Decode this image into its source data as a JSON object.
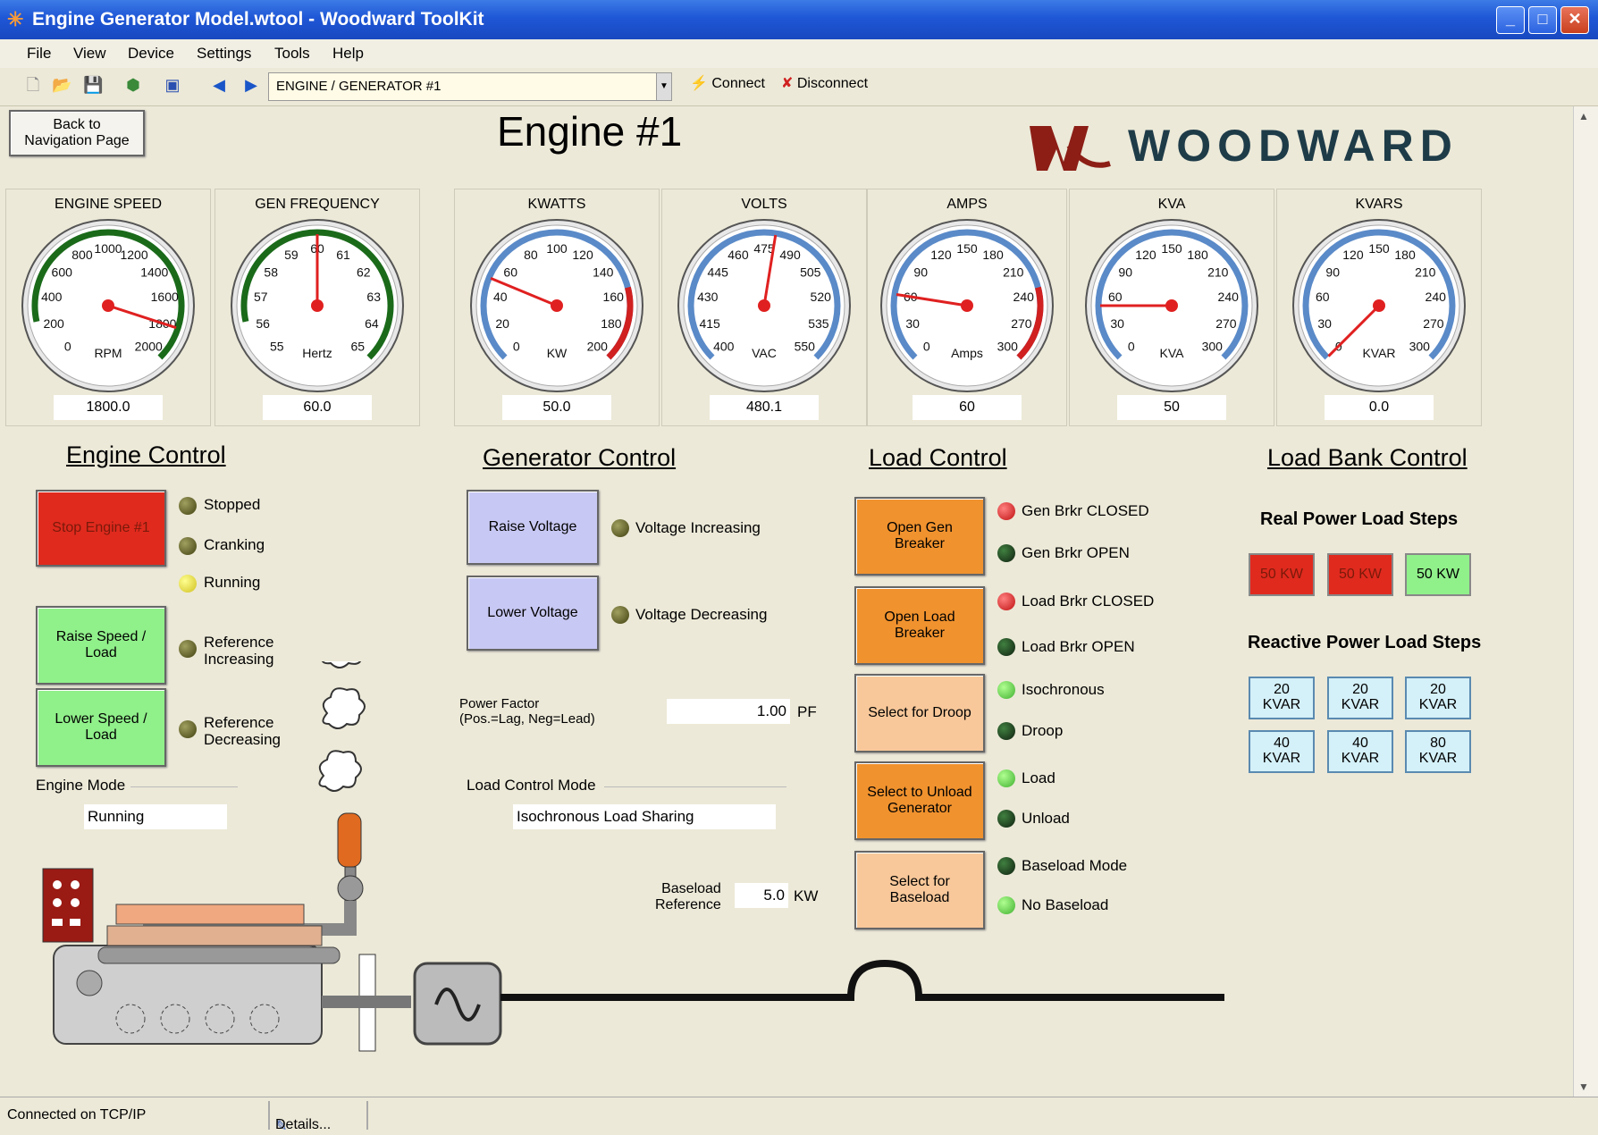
{
  "window": {
    "title": "Engine Generator Model.wtool - Woodward ToolKit"
  },
  "menu": [
    "File",
    "View",
    "Device",
    "Settings",
    "Tools",
    "Help"
  ],
  "toolbar": {
    "combo_value": "ENGINE / GENERATOR #1",
    "connect": "Connect",
    "disconnect": "Disconnect"
  },
  "nav_button": "Back to\nNavigation Page",
  "page_title": "Engine #1",
  "logo": "WOODWARD",
  "gauges": [
    {
      "title": "ENGINE SPEED",
      "unit": "RPM",
      "value": "1800.0",
      "ticks": [
        "0",
        "200",
        "400",
        "600",
        "800",
        "1000",
        "1200",
        "1400",
        "1600",
        "1800",
        "2000"
      ],
      "reading": 1800,
      "min": 0,
      "max": 2000
    },
    {
      "title": "GEN FREQUENCY",
      "unit": "Hertz",
      "value": "60.0",
      "ticks": [
        "55",
        "56",
        "57",
        "58",
        "59",
        "60",
        "61",
        "62",
        "63",
        "64",
        "65"
      ],
      "reading": 60,
      "min": 55,
      "max": 65
    },
    {
      "title": "KWATTS",
      "unit": "KW",
      "value": "50.0",
      "ticks": [
        "0",
        "20",
        "40",
        "60",
        "80",
        "100",
        "120",
        "140",
        "160",
        "180",
        "200"
      ],
      "reading": 50,
      "min": 0,
      "max": 200
    },
    {
      "title": "VOLTS",
      "unit": "VAC",
      "value": "480.1",
      "ticks": [
        "400",
        "415",
        "430",
        "445",
        "460",
        "475",
        "490",
        "505",
        "520",
        "535",
        "550"
      ],
      "reading": 480.1,
      "min": 400,
      "max": 550
    },
    {
      "title": "AMPS",
      "unit": "Amps",
      "value": "60",
      "ticks": [
        "0",
        "30",
        "60",
        "90",
        "120",
        "150",
        "180",
        "210",
        "240",
        "270",
        "300"
      ],
      "reading": 60,
      "min": 0,
      "max": 300
    },
    {
      "title": "KVA",
      "unit": "KVA",
      "value": "50",
      "ticks": [
        "0",
        "30",
        "60",
        "90",
        "120",
        "150",
        "180",
        "210",
        "240",
        "270",
        "300"
      ],
      "reading": 50,
      "min": 0,
      "max": 300
    },
    {
      "title": "KVARS",
      "unit": "KVAR",
      "value": "0.0",
      "ticks": [
        "0",
        "30",
        "60",
        "90",
        "120",
        "150",
        "180",
        "210",
        "240",
        "270",
        "300"
      ],
      "reading": 0,
      "min": 0,
      "max": 300
    }
  ],
  "engine_control": {
    "header": "Engine Control",
    "stop": "Stop Engine #1",
    "raise": "Raise Speed /\nLoad",
    "lower": "Lower Speed /\nLoad",
    "ind_stopped": "Stopped",
    "ind_cranking": "Cranking",
    "ind_running": "Running",
    "ind_ref_inc": "Reference\nIncreasing",
    "ind_ref_dec": "Reference\nDecreasing",
    "mode_label": "Engine Mode",
    "mode_value": "Running"
  },
  "generator_control": {
    "header": "Generator Control",
    "raise": "Raise Voltage",
    "lower": "Lower Voltage",
    "ind_inc": "Voltage Increasing",
    "ind_dec": "Voltage Decreasing",
    "pf_label": "Power Factor\n(Pos.=Lag, Neg=Lead)",
    "pf_value": "1.00",
    "pf_unit": "PF",
    "lcm_label": "Load Control Mode",
    "lcm_value": "Isochronous Load Sharing",
    "base_label": "Baseload\nReference",
    "base_value": "5.0",
    "base_unit": "KW"
  },
  "load_control": {
    "header": "Load Control",
    "open_gen": "Open Gen\nBreaker",
    "open_load": "Open Load\nBreaker",
    "droop": "Select for Droop",
    "unload": "Select to Unload\nGenerator",
    "baseload": "Select for\nBaseload",
    "gen_closed": "Gen Brkr CLOSED",
    "gen_open": "Gen Brkr OPEN",
    "load_closed": "Load Brkr CLOSED",
    "load_open": "Load Brkr OPEN",
    "iso": "Isochronous",
    "droop_ind": "Droop",
    "load": "Load",
    "unload_ind": "Unload",
    "base_mode": "Baseload Mode",
    "no_base": "No Baseload"
  },
  "load_bank": {
    "header": "Load Bank Control",
    "real_title": "Real Power Load Steps",
    "real": [
      "50 KW",
      "50 KW",
      "50 KW"
    ],
    "reactive_title": "Reactive Power Load Steps",
    "reactive": [
      "20\nKVAR",
      "20\nKVAR",
      "20\nKVAR",
      "40\nKVAR",
      "40\nKVAR",
      "80\nKVAR"
    ]
  },
  "status": {
    "connection": "Connected on TCP/IP",
    "details": "Details..."
  },
  "colors": {
    "red": "#e02a1e",
    "green": "#90f08a",
    "lavender": "#c8c8f4",
    "orange": "#f0922e",
    "peach": "#f8c89a",
    "kvar": "#d4f0f8"
  }
}
